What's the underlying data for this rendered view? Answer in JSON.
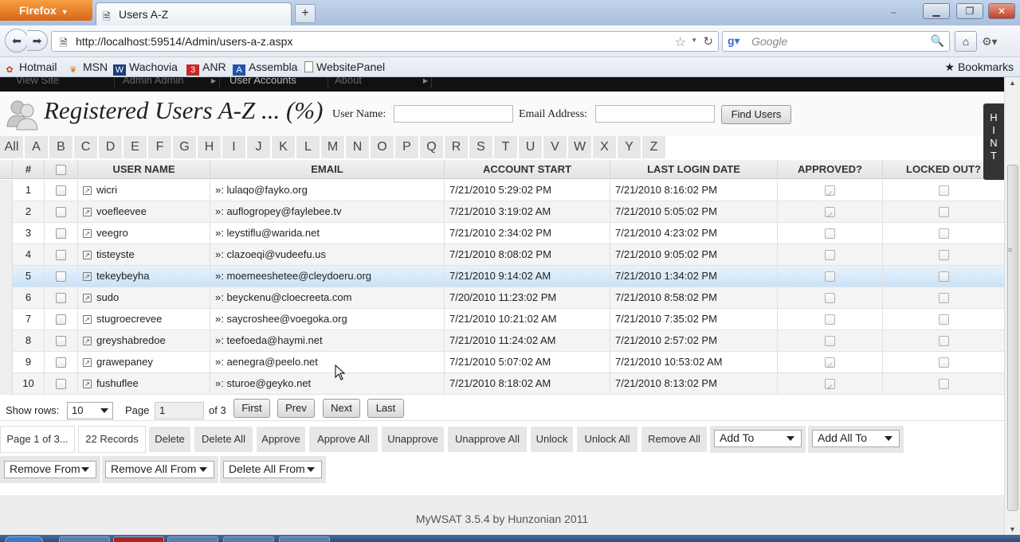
{
  "browser": {
    "app_button": "Firefox",
    "tab_title": "Users A-Z",
    "url": "http://localhost:59514/Admin/users-a-z.aspx",
    "search_placeholder": "Google",
    "bookmarks": [
      "Hotmail",
      "MSN",
      "Wachovia",
      "ANR",
      "Assembla",
      "WebsitePanel"
    ],
    "bookmarks_menu": "Bookmarks"
  },
  "top_menu": [
    "View Site",
    "Admin Admin",
    "User Accounts",
    "About"
  ],
  "header": {
    "title": "Registered Users A-Z ... (%)",
    "username_label": "User Name:",
    "email_label": "Email Address:",
    "find_button": "Find Users"
  },
  "alphabet": [
    "All",
    "A",
    "B",
    "C",
    "D",
    "E",
    "F",
    "G",
    "H",
    "I",
    "J",
    "K",
    "L",
    "M",
    "N",
    "O",
    "P",
    "Q",
    "R",
    "S",
    "T",
    "U",
    "V",
    "W",
    "X",
    "Y",
    "Z"
  ],
  "grid": {
    "columns": [
      "#",
      "",
      "USER NAME",
      "EMAIL",
      "ACCOUNT START",
      "LAST LOGIN DATE",
      "APPROVED?",
      "LOCKED OUT?"
    ],
    "rows": [
      {
        "num": "1",
        "user": "wicri",
        "email": "»: lulaqo@fayko.org",
        "start": "7/21/2010 5:29:02 PM",
        "login": "7/21/2010 8:16:02 PM",
        "approved": true,
        "locked": false
      },
      {
        "num": "2",
        "user": "voefleevee",
        "email": "»: auflogropey@faylebee.tv",
        "start": "7/21/2010 3:19:02 AM",
        "login": "7/21/2010 5:05:02 PM",
        "approved": true,
        "locked": false
      },
      {
        "num": "3",
        "user": "veegro",
        "email": "»: leystiflu@warida.net",
        "start": "7/21/2010 2:34:02 PM",
        "login": "7/21/2010 4:23:02 PM",
        "approved": false,
        "locked": false
      },
      {
        "num": "4",
        "user": "tisteyste",
        "email": "»: clazoeqi@vudeefu.us",
        "start": "7/21/2010 8:08:02 PM",
        "login": "7/21/2010 9:05:02 PM",
        "approved": false,
        "locked": false
      },
      {
        "num": "5",
        "user": "tekeybeyha",
        "email": "»: moemeeshetee@cleydoeru.org",
        "start": "7/21/2010 9:14:02 AM",
        "login": "7/21/2010 1:34:02 PM",
        "approved": false,
        "locked": false
      },
      {
        "num": "6",
        "user": "sudo",
        "email": "»: beyckenu@cloecreeta.com",
        "start": "7/20/2010 11:23:02 PM",
        "login": "7/21/2010 8:58:02 PM",
        "approved": false,
        "locked": false
      },
      {
        "num": "7",
        "user": "stugroecrevee",
        "email": "»: saycroshee@voegoka.org",
        "start": "7/21/2010 10:21:02 AM",
        "login": "7/21/2010 7:35:02 PM",
        "approved": false,
        "locked": false
      },
      {
        "num": "8",
        "user": "greyshabredoe",
        "email": "»: teefoeda@haymi.net",
        "start": "7/21/2010 11:24:02 AM",
        "login": "7/21/2010 2:57:02 PM",
        "approved": false,
        "locked": false
      },
      {
        "num": "9",
        "user": "grawepaney",
        "email": "»: aenegra@peelo.net",
        "start": "7/21/2010 5:07:02 AM",
        "login": "7/21/2010 10:53:02 AM",
        "approved": true,
        "locked": false
      },
      {
        "num": "10",
        "user": "fushuflee",
        "email": "»: sturoe@geyko.net",
        "start": "7/21/2010 8:18:02 AM",
        "login": "7/21/2010 8:13:02 PM",
        "approved": true,
        "locked": false
      }
    ]
  },
  "pager": {
    "show_rows_label": "Show rows:",
    "rows_value": "10",
    "page_label": "Page",
    "page_value": "1",
    "of_label": "of 3",
    "first": "First",
    "prev": "Prev",
    "next": "Next",
    "last": "Last"
  },
  "actions": {
    "page_info": "Page 1 of 3...",
    "records": "22 Records",
    "buttons": [
      "Delete",
      "Delete All",
      "Approve",
      "Approve All",
      "Unapprove",
      "Unapprove All",
      "Unlock",
      "Unlock All",
      "Remove All"
    ],
    "add_to": "Add To",
    "add_all_to": "Add All To",
    "remove_from": "Remove From",
    "remove_all_from": "Remove All From",
    "delete_all_from": "Delete All From"
  },
  "hint_letters": [
    "H",
    "I",
    "N",
    "T"
  ],
  "footer": "MyWSAT 3.5.4 by Hunzonian 2011",
  "colors": {
    "selected_row": "#c9e2f8",
    "firefox_orange": "#e07a24"
  }
}
